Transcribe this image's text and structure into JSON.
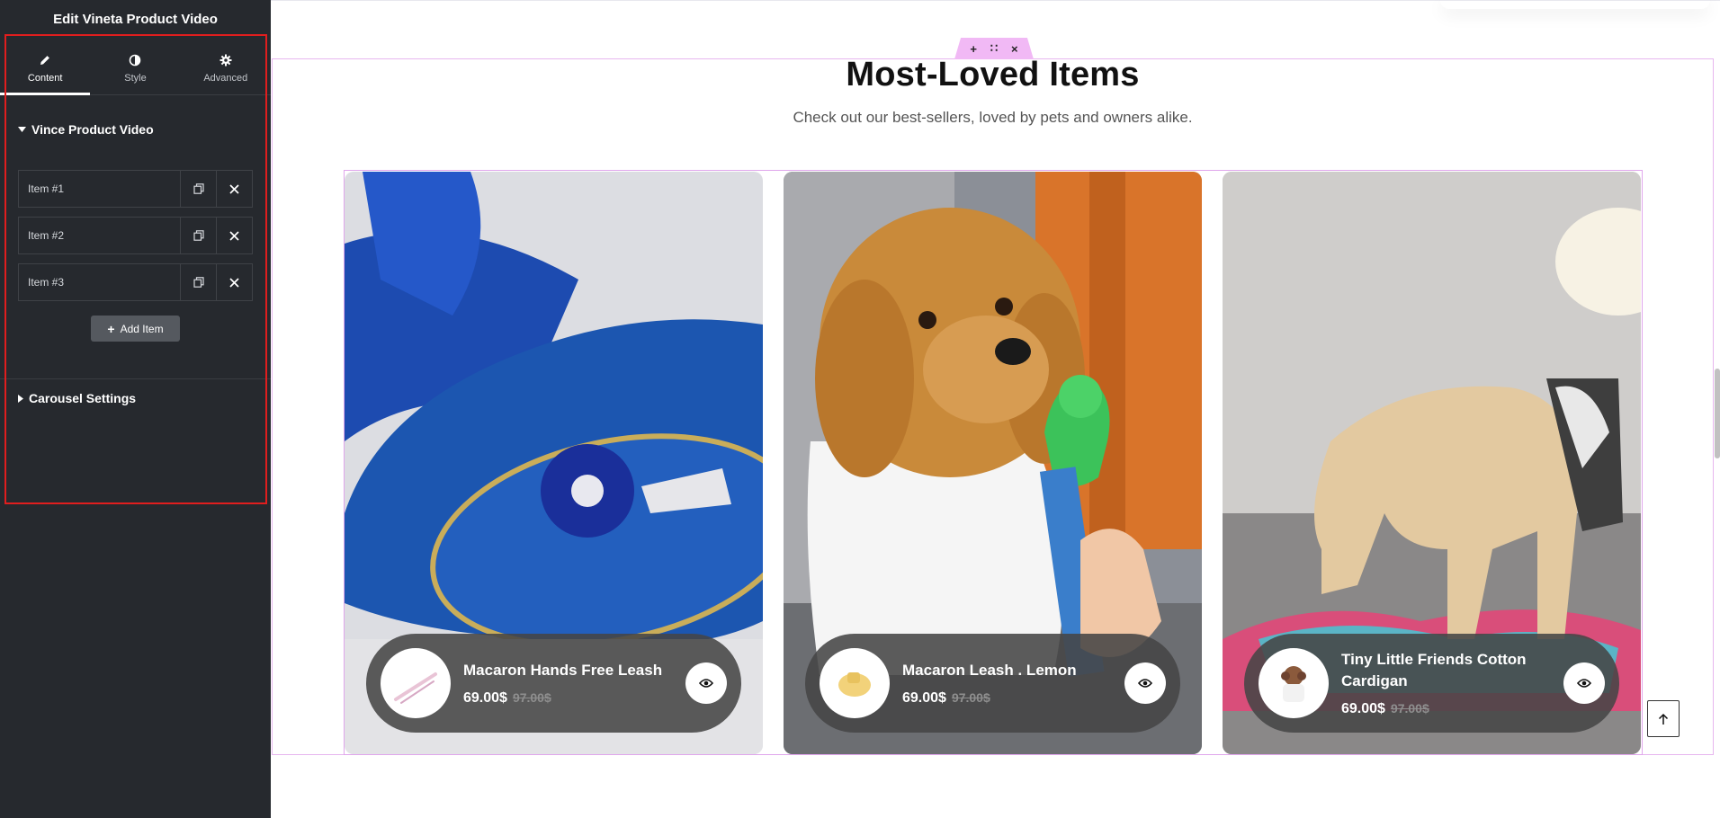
{
  "panel": {
    "title": "Edit Vineta Product Video",
    "tabs": [
      {
        "label": "Content",
        "icon": "pencil-icon"
      },
      {
        "label": "Style",
        "icon": "half-circle-icon"
      },
      {
        "label": "Advanced",
        "icon": "gear-icon"
      }
    ],
    "section1": "Vince Product Video",
    "items": [
      "Item #1",
      "Item #2",
      "Item #3"
    ],
    "add_item": "Add Item",
    "section2": "Carousel Settings"
  },
  "canvas": {
    "heading": "Most-Loved Items",
    "subheading": "Check out our best-sellers, loved by pets and owners alike.",
    "handle": {
      "add": "+",
      "drag": "∷",
      "close": "×"
    },
    "products": [
      {
        "name": "Macaron Hands Free Leash",
        "price": "69.00$",
        "old_price": "97.00$"
      },
      {
        "name": "Macaron Leash . Lemon",
        "price": "69.00$",
        "old_price": "97.00$"
      },
      {
        "name": "Tiny Little Friends Cotton Cardigan",
        "price": "69.00$",
        "old_price": "97.00$"
      }
    ]
  },
  "colors": {
    "panel_bg": "#26292e",
    "highlight": "#e01e1e",
    "editor_outline": "#e7b6ef",
    "card_overlay": "#464646"
  }
}
